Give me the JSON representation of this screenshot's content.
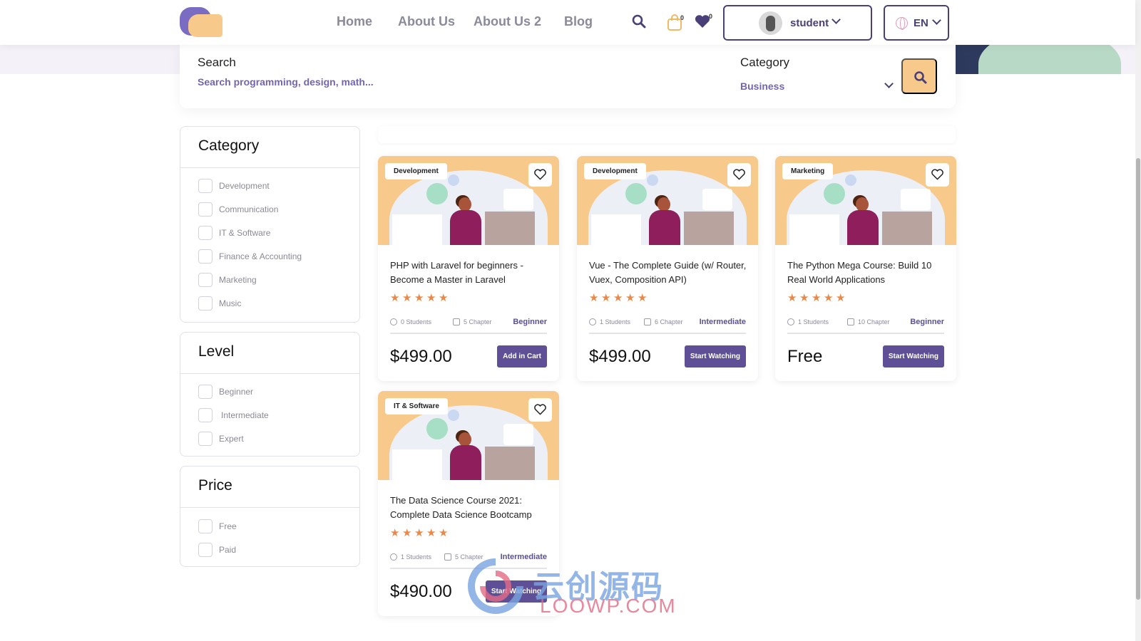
{
  "header": {
    "nav": [
      "Home",
      "About Us",
      "About Us 2",
      "Blog"
    ],
    "cart_count": "0",
    "wishlist_count": "0",
    "user_name": "student",
    "language": "EN"
  },
  "search": {
    "label": "Search",
    "placeholder": "Search programming, design, math...",
    "category_label": "Category",
    "category_value": "Business"
  },
  "filters": {
    "category": {
      "title": "Category",
      "items": [
        "Development",
        "Communication",
        "IT & Software",
        "Finance & Accounting",
        "Marketing",
        "Music"
      ]
    },
    "level": {
      "title": "Level",
      "items": [
        "Beginner",
        "Intermediate",
        "Expert"
      ]
    },
    "price": {
      "title": "Price",
      "items": [
        "Free",
        "Paid"
      ]
    }
  },
  "courses": [
    {
      "tag": "Development",
      "title": "PHP with Laravel for beginners - Become a Master in Laravel",
      "rating": 5,
      "students": "0 Students",
      "chapters": "5 Chapter",
      "level": "Beginner",
      "price": "$499.00",
      "button": "Add in Cart"
    },
    {
      "tag": "Development",
      "title": "Vue - The Complete Guide (w/ Router, Vuex, Composition API)",
      "rating": 5,
      "students": "1 Students",
      "chapters": "6 Chapter",
      "level": "Intermediate",
      "price": "$499.00",
      "button": "Start Watching"
    },
    {
      "tag": "Marketing",
      "title": "The Python Mega Course: Build 10 Real World Applications",
      "rating": 5,
      "students": "1 Students",
      "chapters": "10 Chapter",
      "level": "Beginner",
      "price": "Free",
      "button": "Start Watching"
    },
    {
      "tag": "IT & Software",
      "title": "The Data Science Course 2021: Complete Data Science Bootcamp",
      "rating": 5,
      "students": "1 Students",
      "chapters": "5 Chapter",
      "level": "Intermediate",
      "price": "$490.00",
      "button": "Start Watching"
    }
  ],
  "watermark": {
    "cn": "云创源码",
    "en": "LOOWP.COM"
  },
  "colors": {
    "brand_purple": "#5e4f96",
    "accent_orange": "#f7c98b",
    "star": "#e8894a"
  }
}
